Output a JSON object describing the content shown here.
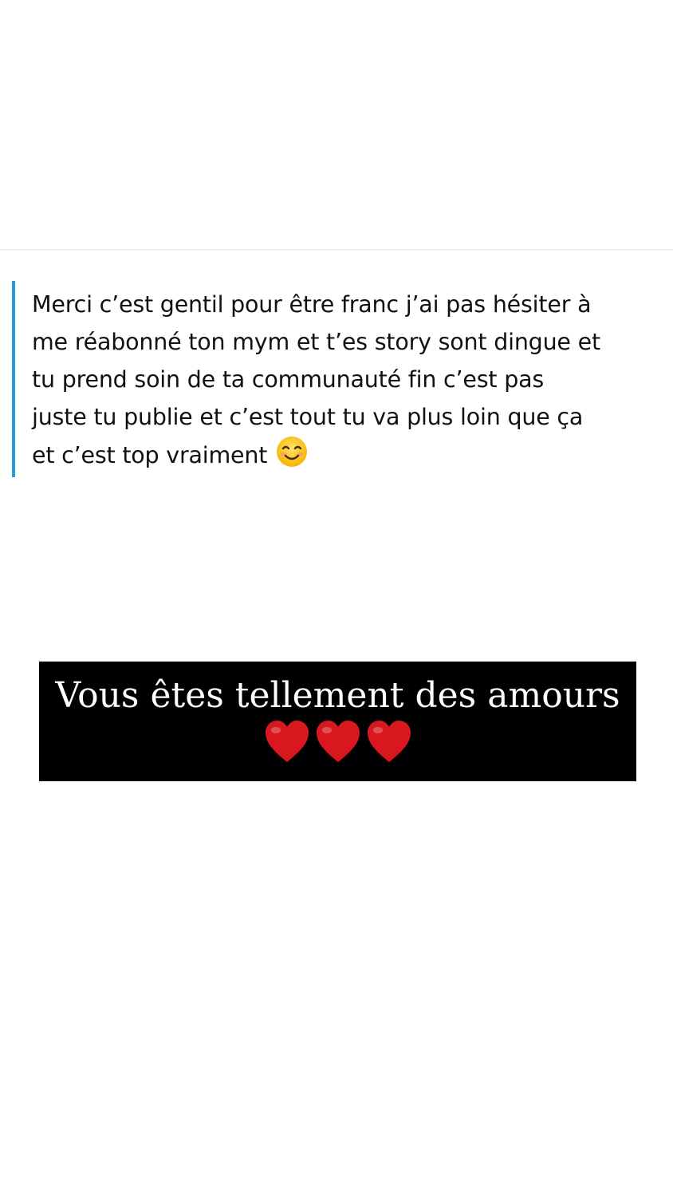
{
  "message": {
    "lines": [
      "Merci c’est gentil pour être franc j’ai pas hésiter à",
      "me réabonné ton mym et t’es story sont dingue et",
      "tu prend soin de ta communauté fin c’est pas",
      "juste tu publie et c’est tout tu va plus loin que ça",
      "et c’est top vraiment"
    ],
    "trailing_emoji": "smiling-face-icon",
    "accent_color": "#2b9bd3"
  },
  "caption": {
    "text": "Vous êtes tellement des amours",
    "emoji": [
      "heart-icon",
      "heart-icon",
      "heart-icon"
    ],
    "background": "#000000",
    "text_color": "#ffffff"
  }
}
